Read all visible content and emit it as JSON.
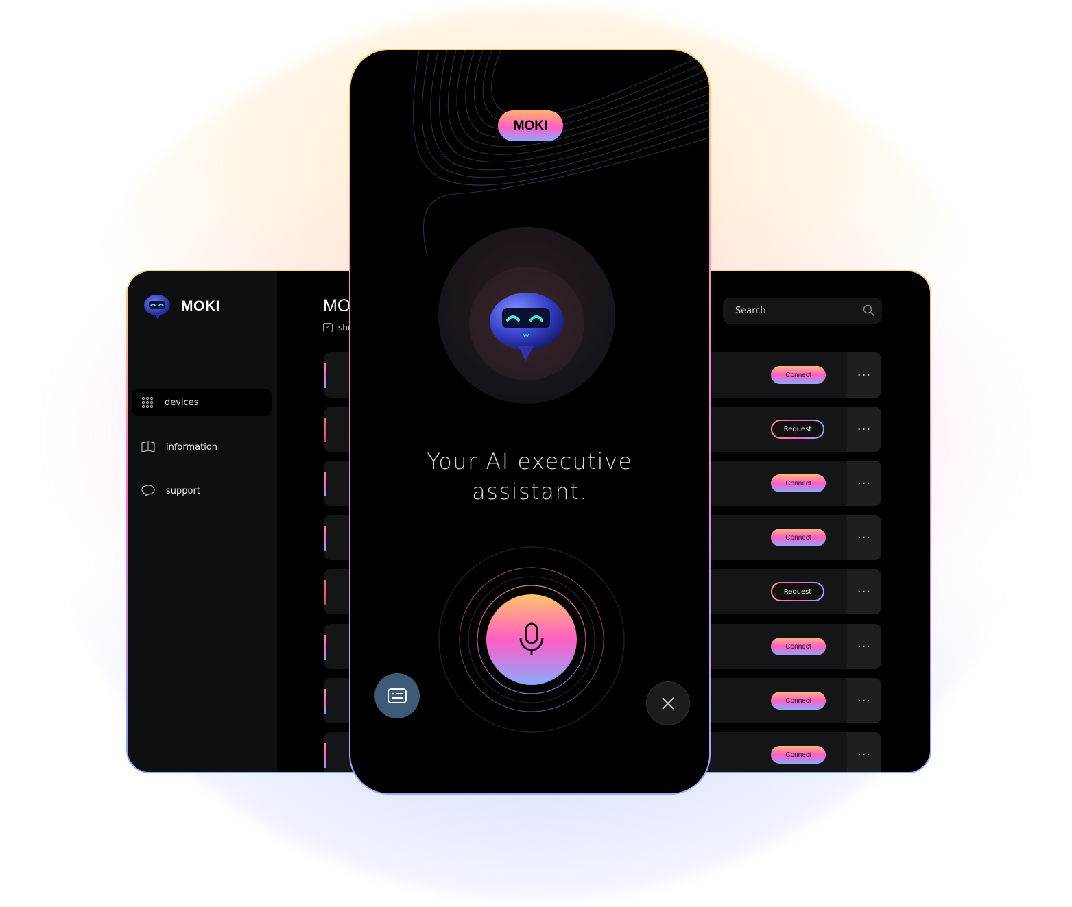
{
  "brand": {
    "name": "MOKI",
    "accent_from": "#ffb36b",
    "accent_mid": "#ff5ec4",
    "accent_to": "#8aa8ff"
  },
  "desktop": {
    "sidebar": {
      "items": [
        {
          "label": "devices",
          "icon": "grid-icon",
          "active": true
        },
        {
          "label": "information",
          "icon": "book-icon",
          "active": false
        },
        {
          "label": "support",
          "icon": "chat-bubble-icon",
          "active": false
        }
      ]
    },
    "main": {
      "title": "MO",
      "filter_label": "sho",
      "search_placeholder": "Search"
    },
    "rows": [
      {
        "action": "Connect",
        "bar": "gradient"
      },
      {
        "action": "Request",
        "bar": "red"
      },
      {
        "action": "Connect",
        "bar": "gradient"
      },
      {
        "action": "Connect",
        "bar": "gradient"
      },
      {
        "action": "Request",
        "bar": "red"
      },
      {
        "action": "Connect",
        "bar": "gradient"
      },
      {
        "action": "Connect",
        "bar": "gradient"
      },
      {
        "action": "Connect",
        "bar": "gradient"
      }
    ],
    "more_label": "···"
  },
  "phone": {
    "pill_label": "MOKI",
    "tagline_line1": "Your AI executive",
    "tagline_line2": "assistant.",
    "mic_icon": "microphone-icon",
    "keyboard_icon": "keyboard-icon",
    "close_icon": "close-icon"
  }
}
